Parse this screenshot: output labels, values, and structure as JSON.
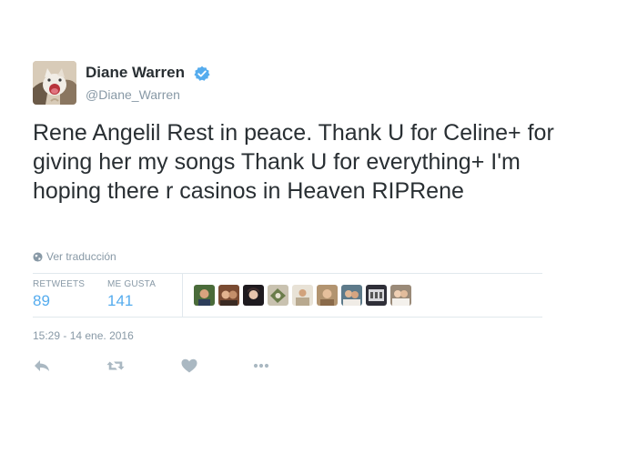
{
  "user": {
    "display_name": "Diane Warren",
    "screen_name": "@Diane_Warren",
    "verified_icon": "verified-badge-icon",
    "avatar_icon": "cat-avatar"
  },
  "tweet": {
    "text": "Rene Angelil Rest in peace. Thank U for Celine+ for giving her my songs Thank U for everything+ I'm hoping there r casinos in Heaven RIPRene",
    "translate_label": "Ver traducción",
    "timestamp": "15:29 - 14 ene. 2016"
  },
  "stats": {
    "retweets_label": "RETWEETS",
    "retweets_count": "89",
    "likes_label": "ME GUSTA",
    "likes_count": "141"
  },
  "facepile": {
    "count": 10
  },
  "actions": [
    {
      "name": "reply-icon"
    },
    {
      "name": "retweet-icon"
    },
    {
      "name": "like-heart-icon"
    },
    {
      "name": "more-options-icon"
    }
  ],
  "colors": {
    "accent": "#55acee",
    "muted": "#8899a6",
    "text": "#292f33",
    "border": "#e1e8ed",
    "icon": "#aab8c2"
  }
}
